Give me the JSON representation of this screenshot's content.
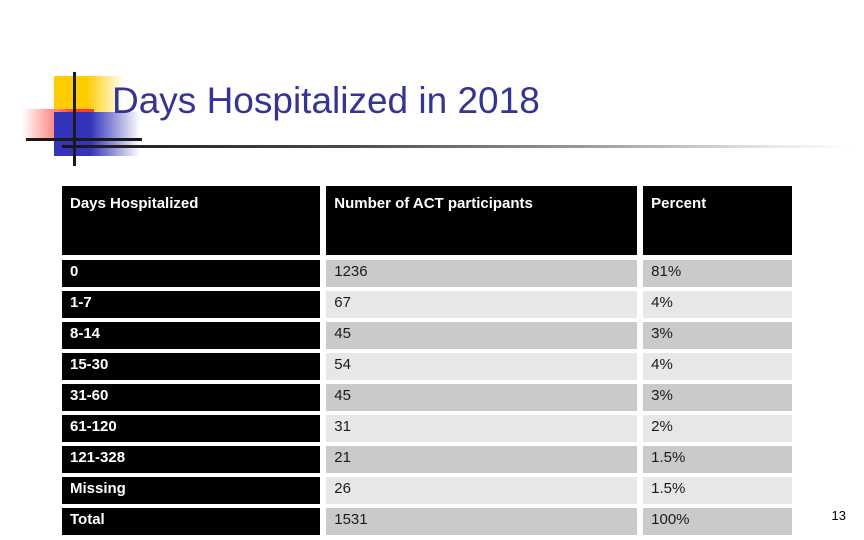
{
  "slide": {
    "title": "Days Hospitalized in 2018",
    "page_number": "13",
    "accent_colors": {
      "title_blue": "#333399",
      "deco_yellow": "#ffcc00",
      "deco_red": "#ff3b33",
      "deco_blue": "#3333bb",
      "header_bg": "#000000",
      "band_dark": "#cacaca",
      "band_light": "#e7e7e7"
    }
  },
  "table": {
    "headers": [
      "Days Hospitalized",
      "Number of ACT participants",
      "Percent"
    ],
    "rows": [
      {
        "days": "0",
        "count": "1236",
        "percent": "81%"
      },
      {
        "days": "1-7",
        "count": "67",
        "percent": "4%"
      },
      {
        "days": "8-14",
        "count": "45",
        "percent": "3%"
      },
      {
        "days": "15-30",
        "count": "54",
        "percent": "4%"
      },
      {
        "days": "31-60",
        "count": "45",
        "percent": "3%"
      },
      {
        "days": "61-120",
        "count": "31",
        "percent": "2%"
      },
      {
        "days": "121-328",
        "count": "21",
        "percent": "1.5%"
      },
      {
        "days": "Missing",
        "count": "26",
        "percent": "1.5%"
      },
      {
        "days": "Total",
        "count": "1531",
        "percent": "100%"
      }
    ]
  }
}
